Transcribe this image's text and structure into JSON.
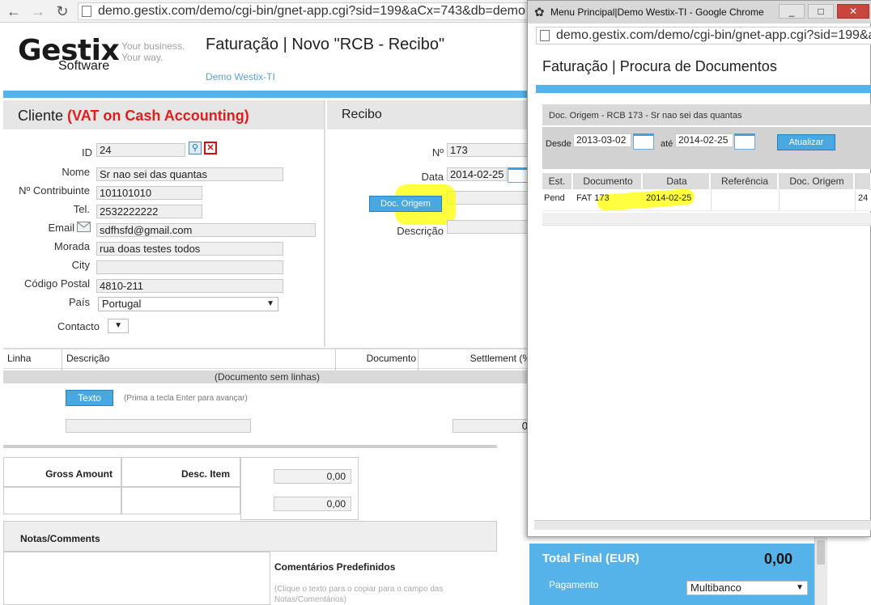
{
  "browser": {
    "url": "demo.gestix.com/demo/cgi-bin/gnet-app.cgi?sid=199&aCx=743&db=demo"
  },
  "header": {
    "logo": "Gestix",
    "logo_sub": "Software",
    "tagline_1": "Your business.",
    "tagline_2": "Your way.",
    "title": "Faturação | Novo \"RCB - Recibo\"",
    "company": "Demo Westix-TI"
  },
  "cliente": {
    "title": "Cliente",
    "vat": "(VAT on Cash Accounting)",
    "labels": {
      "id": "ID",
      "nome": "Nome",
      "nif": "Nº Contribuinte",
      "tel": "Tel.",
      "email": "Email",
      "morada": "Morada",
      "city": "City",
      "cp": "Código Postal",
      "pais": "País",
      "contacto": "Contacto"
    },
    "values": {
      "id": "24",
      "nome": "Sr nao sei das quantas",
      "nif": "101101010",
      "tel": "2532222222",
      "email": "sdfhsfd@gmail.com",
      "morada": "rua doas testes todos",
      "city": "",
      "cp": "4810-211",
      "pais": "Portugal"
    }
  },
  "recibo": {
    "title": "Recibo",
    "labels": {
      "numero": "Nº",
      "data": "Data",
      "descricao": "Descrição"
    },
    "values": {
      "numero": "173",
      "data": "2014-02-25"
    },
    "doc_origem_button": "Doc. Origem"
  },
  "lines": {
    "columns": [
      "Linha",
      "Descrição",
      "Documento",
      "Settlement (%"
    ],
    "empty": "(Documento sem linhas)",
    "texto_button": "Texto",
    "hint": "(Prima a tecla Enter para avançar)",
    "total_value": "0"
  },
  "summary": {
    "gross_amount": "Gross Amount",
    "desc_item": "Desc. Item",
    "value_1": "0,00",
    "value_2": "0,00"
  },
  "notas": {
    "title": "Notas/Comments",
    "comentarios": "Comentários Predefinidos",
    "comentarios_hint": "(Clique o texto para o copiar para o campo das Notas/Comentários)"
  },
  "totals": {
    "total_final_label": "Total Final (EUR)",
    "total_final_value": "0,00",
    "pagamento_label": "Pagamento",
    "pagamento_value": "Multibanco"
  },
  "popup": {
    "window_title": "Menu Principal|Demo Westix-TI - Google Chrome",
    "url": "demo.gestix.com/demo/cgi-bin/gnet-app.cgi?sid=199&a",
    "title": "Faturação | Procura de Documentos",
    "filter_caption": "Doc. Origem - RCB 173 - Sr nao sei das quantas",
    "desde_label": "Desde",
    "desde_value": "2013-03-02",
    "ate_label": "até",
    "ate_value": "2014-02-25",
    "atualizar": "Atualizar",
    "columns": [
      "Est.",
      "Documento",
      "Data",
      "Referência",
      "Doc. Origem"
    ],
    "row": {
      "est": "Pend",
      "documento": "FAT 173",
      "data": "2014-02-25",
      "extra": "24"
    }
  },
  "colors": {
    "accent": "#56b3e9",
    "vat_red": "#e01e1e",
    "highlight": "#ffff00"
  }
}
